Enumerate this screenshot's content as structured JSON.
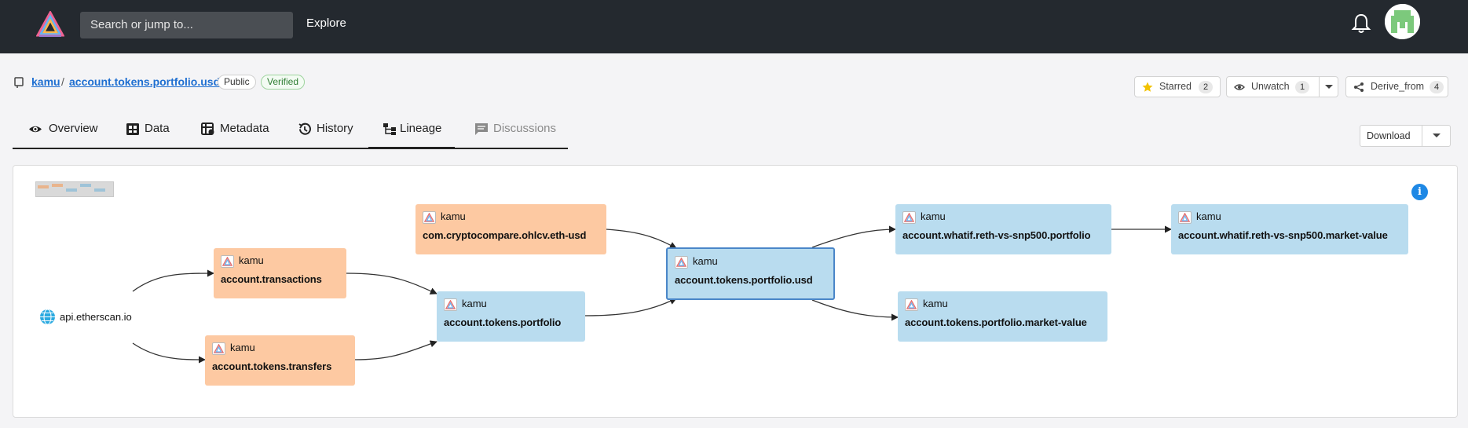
{
  "header": {
    "search_placeholder": "Search or jump to...",
    "explore_label": "Explore"
  },
  "breadcrumb": {
    "account": "kamu",
    "separator": "/",
    "dataset": "account.tokens.portfolio.usd",
    "badge_public": "Public",
    "badge_verified": "Verified"
  },
  "actions": {
    "starred_label": "Starred",
    "starred_count": "2",
    "unwatch_label": "Unwatch",
    "unwatch_count": "1",
    "derive_label": "Derive_from",
    "derive_count": "4"
  },
  "tabs": [
    {
      "label": "Overview",
      "icon": "eye-icon"
    },
    {
      "label": "Data",
      "icon": "grid-icon"
    },
    {
      "label": "Metadata",
      "icon": "metadata-icon"
    },
    {
      "label": "History",
      "icon": "history-icon"
    },
    {
      "label": "Lineage",
      "icon": "lineage-icon"
    },
    {
      "label": "Discussions",
      "icon": "comment-icon"
    }
  ],
  "active_tab": "Lineage",
  "download_label": "Download",
  "lineage": {
    "source": {
      "label": "api.etherscan.io",
      "icon": "globe-icon"
    },
    "nodes": [
      {
        "account": "kamu",
        "name": "account.transactions",
        "kind": "root",
        "color": "#fdc9a2"
      },
      {
        "account": "kamu",
        "name": "account.tokens.transfers",
        "kind": "root",
        "color": "#fdc9a2"
      },
      {
        "account": "kamu",
        "name": "com.cryptocompare.ohlcv.eth-usd",
        "kind": "root",
        "color": "#fdc9a2"
      },
      {
        "account": "kamu",
        "name": "account.tokens.portfolio",
        "kind": "derivative",
        "color": "#b9dcef"
      },
      {
        "account": "kamu",
        "name": "account.tokens.portfolio.usd",
        "kind": "derivative",
        "color": "#b9dcef",
        "selected": true
      },
      {
        "account": "kamu",
        "name": "account.whatif.reth-vs-snp500.portfolio",
        "kind": "derivative",
        "color": "#b9dcef"
      },
      {
        "account": "kamu",
        "name": "account.tokens.portfolio.market-value",
        "kind": "derivative",
        "color": "#b9dcef"
      },
      {
        "account": "kamu",
        "name": "account.whatif.reth-vs-snp500.market-value",
        "kind": "derivative",
        "color": "#b9dcef"
      }
    ]
  }
}
